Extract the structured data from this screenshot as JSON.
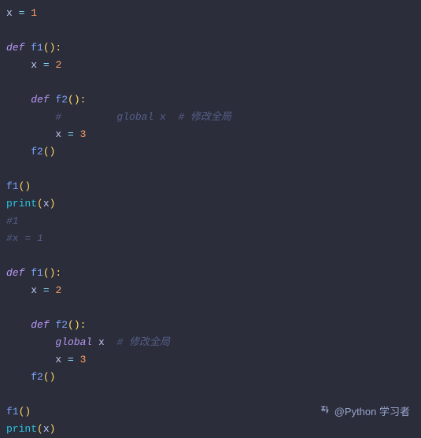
{
  "code": {
    "l1_var": "x",
    "l1_op": " = ",
    "l1_val": "1",
    "l3_def": "def ",
    "l3_fn": "f1",
    "l3_parens": "():",
    "l4_var": "x",
    "l4_op": " = ",
    "l4_val": "2",
    "l6_def": "def ",
    "l6_fn": "f2",
    "l6_parens": "():",
    "l7_comment": "#         global x  # 修改全局",
    "l8_var": "x",
    "l8_op": " = ",
    "l8_val": "3",
    "l9_fn": "f2",
    "l9_parens": "()",
    "l11_fn": "f1",
    "l11_parens": "()",
    "l12_fn": "print",
    "l12_open": "(",
    "l12_arg": "x",
    "l12_close": ")",
    "l13_comment": "#1",
    "l14_comment": "#x = 1",
    "l16_def": "def ",
    "l16_fn": "f1",
    "l16_parens": "():",
    "l17_var": "x",
    "l17_op": " = ",
    "l17_val": "2",
    "l19_def": "def ",
    "l19_fn": "f2",
    "l19_parens": "():",
    "l20_global": "global ",
    "l20_var": "x",
    "l20_comment": "  # 修改全局",
    "l21_var": "x",
    "l21_op": " = ",
    "l21_val": "3",
    "l22_fn": "f2",
    "l22_parens": "()",
    "l24_fn": "f1",
    "l24_parens": "()",
    "l25_fn": "print",
    "l25_open": "(",
    "l25_arg": "x",
    "l25_close": ")"
  },
  "watermark": {
    "text": "@Python 学习者"
  }
}
